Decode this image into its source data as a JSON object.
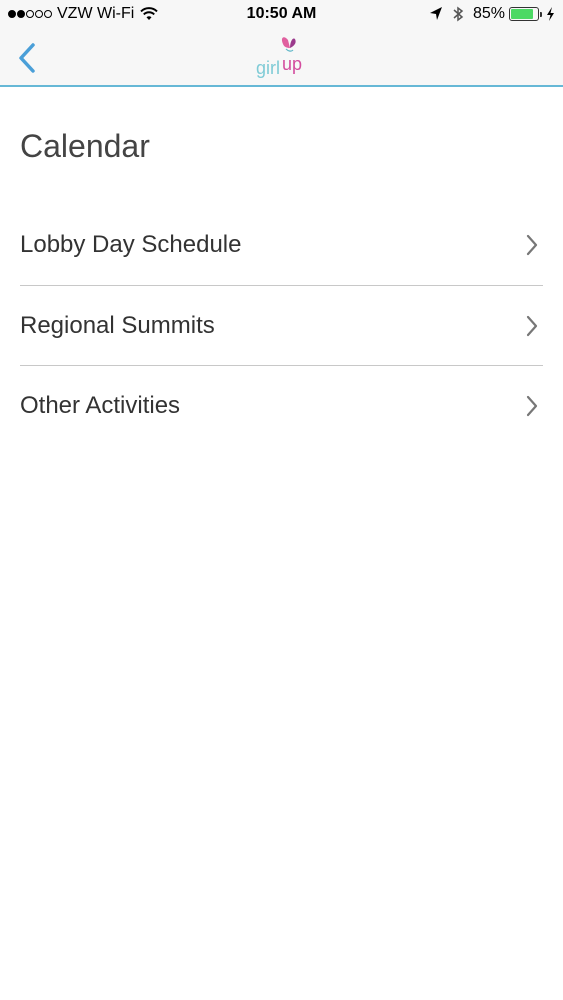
{
  "status_bar": {
    "carrier": "VZW Wi-Fi",
    "time": "10:50 AM",
    "battery_percent": "85%",
    "battery_level": 0.85,
    "signal_bars_filled": 2,
    "signal_bars_total": 5
  },
  "nav": {
    "back_icon": "chevron-left-icon",
    "logo_text_girl": "girl",
    "logo_text_up": "up",
    "accent_color": "#4a9fd8",
    "logo_teal": "#7fcbd6",
    "logo_pink": "#d34c9e"
  },
  "page": {
    "title": "Calendar"
  },
  "menu": {
    "items": [
      {
        "label": "Lobby Day Schedule",
        "icon": "chevron-right-icon"
      },
      {
        "label": "Regional Summits",
        "icon": "chevron-right-icon"
      },
      {
        "label": "Other Activities",
        "icon": "chevron-right-icon"
      }
    ]
  }
}
